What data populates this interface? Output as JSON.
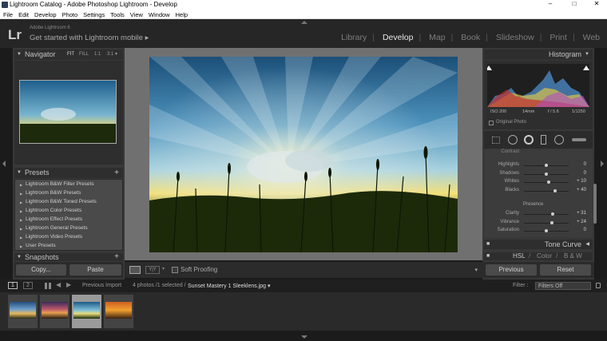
{
  "window": {
    "title": "Lightroom Catalog - Adobe Photoshop Lightroom - Develop",
    "controls": [
      "–",
      "□",
      "✕"
    ]
  },
  "menu": [
    "File",
    "Edit",
    "Develop",
    "Photo",
    "Settings",
    "Tools",
    "View",
    "Window",
    "Help"
  ],
  "header": {
    "logo": "Lr",
    "product": "Adobe Lightroom 6",
    "tagline": "Get started with Lightroom mobile ▸",
    "modules": [
      "Library",
      "Develop",
      "Map",
      "Book",
      "Slideshow",
      "Print",
      "Web"
    ],
    "active_module": "Develop"
  },
  "left_panel": {
    "navigator": {
      "title": "Navigator",
      "zoom_options": [
        "FIT",
        "FILL",
        "1:1",
        "3:1 ▾"
      ]
    },
    "presets": {
      "title": "Presets",
      "items": [
        "Lightroom B&W Filter Presets",
        "Lightroom B&W Presets",
        "Lightroom B&W Toned Presets",
        "Lightroom Color Presets",
        "Lightroom Effect Presets",
        "Lightroom General Presets",
        "Lightroom Video Presets",
        "User Presets"
      ]
    },
    "snapshots_title": "Snapshots",
    "copy_label": "Copy...",
    "paste_label": "Paste"
  },
  "toolbar": {
    "soft_proofing": "Soft Proofing"
  },
  "right_panel": {
    "histogram": {
      "title": "Histogram",
      "info": [
        "ISO 200",
        "14mm",
        "f / 5.6",
        "1/1250"
      ],
      "original_photo": "Original Photo"
    },
    "basic_partial_label": "Contrast",
    "tone_sliders": [
      {
        "label": "Highlights",
        "value": "0",
        "level": 0.5
      },
      {
        "label": "Shadows",
        "value": "0",
        "level": 0.5
      },
      {
        "label": "Whites",
        "value": "+ 10",
        "level": 0.55
      },
      {
        "label": "Blacks",
        "value": "+ 40",
        "level": 0.7
      }
    ],
    "presence_label": "Presence",
    "presence_sliders": [
      {
        "label": "Clarity",
        "value": "+ 31",
        "level": 0.65
      },
      {
        "label": "Vibrance",
        "value": "+ 24",
        "level": 0.62
      },
      {
        "label": "Saturation",
        "value": "0",
        "level": 0.5
      }
    ],
    "tone_curve": "Tone Curve",
    "hsl_tabs": [
      "HSL",
      "/",
      "Color",
      "/",
      "B & W"
    ],
    "previous_label": "Previous",
    "reset_label": "Reset"
  },
  "filmstrip": {
    "page_buttons": [
      "1",
      "2"
    ],
    "source_prev": "Previous Import",
    "status": "4 photos /1 selected /",
    "filename": "Sunset Mastery 1 Sleeklens.jpg ▾",
    "filter_label": "Filter :",
    "filter_value": "Filters Off"
  }
}
